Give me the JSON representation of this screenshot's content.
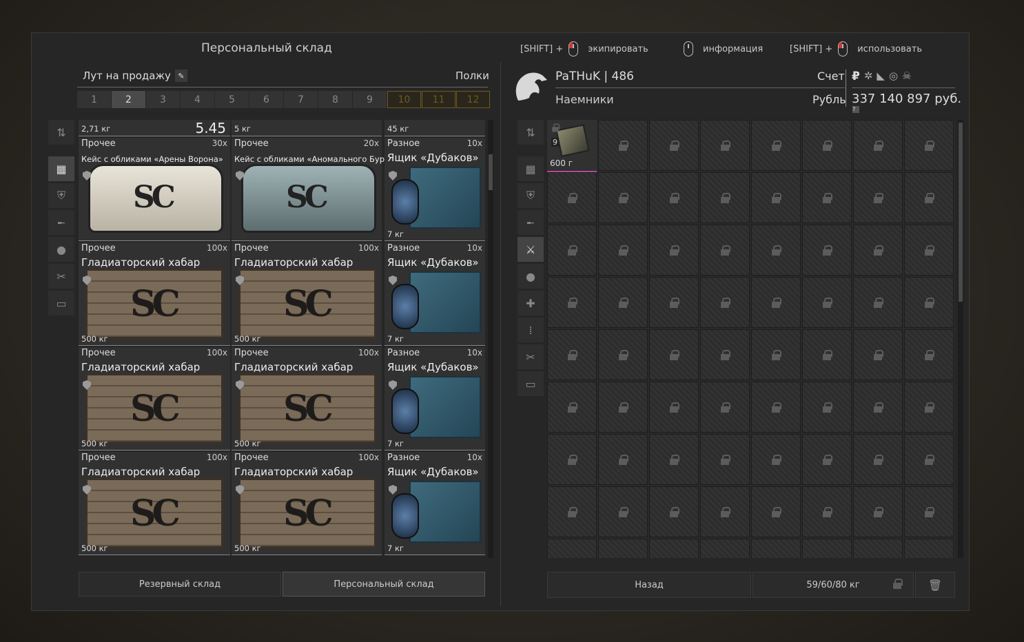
{
  "header": {
    "title": "Персональный склад",
    "hints": [
      {
        "pre": "[SHIFT] +",
        "label": "экипировать"
      },
      {
        "pre": "",
        "label": "информация"
      },
      {
        "pre": "[SHIFT] +",
        "label": "использовать"
      }
    ]
  },
  "left": {
    "sell_label": "Лут на продажу",
    "shelves_label": "Полки",
    "pages": [
      "1",
      "2",
      "3",
      "4",
      "5",
      "6",
      "7",
      "8",
      "9",
      "10",
      "11",
      "12"
    ],
    "active_page": "2",
    "top_row": [
      {
        "weight": "2,71 кг",
        "price": "5.45"
      },
      {
        "weight": "5 кг"
      },
      {
        "weight": "45 кг"
      }
    ],
    "items": [
      [
        {
          "cat": "Прочее",
          "count": "30x",
          "name": "Кейс с обликами «Арены Ворона»",
          "weight": ""
        },
        {
          "cat": "Прочее",
          "count": "20x",
          "name": "Кейс с обликами «Аномального Бура...",
          "weight": ""
        },
        {
          "cat": "Разное",
          "count": "10x",
          "name": "Ящик «Дубаков»",
          "weight": "7 кг"
        }
      ],
      [
        {
          "cat": "Прочее",
          "count": "100x",
          "name": "Гладиаторский хабар",
          "weight": "500 кг"
        },
        {
          "cat": "Прочее",
          "count": "100x",
          "name": "Гладиаторский хабар",
          "weight": "500 кг"
        },
        {
          "cat": "Разное",
          "count": "10x",
          "name": "Ящик «Дубаков»",
          "weight": "7 кг"
        }
      ],
      [
        {
          "cat": "Прочее",
          "count": "100x",
          "name": "Гладиаторский хабар",
          "weight": "500 кг"
        },
        {
          "cat": "Прочее",
          "count": "100x",
          "name": "Гладиаторский хабар",
          "weight": "500 кг"
        },
        {
          "cat": "Разное",
          "count": "10x",
          "name": "Ящик «Дубаков»",
          "weight": "7 кг"
        }
      ],
      [
        {
          "cat": "Прочее",
          "count": "100x",
          "name": "Гладиаторский хабар",
          "weight": "500 кг"
        },
        {
          "cat": "Прочее",
          "count": "100x",
          "name": "Гладиаторский хабар",
          "weight": "500 кг"
        },
        {
          "cat": "Разное",
          "count": "10x",
          "name": "Ящик «Дубаков»",
          "weight": "7 кг"
        }
      ]
    ],
    "btn_reserve": "Резервный склад",
    "btn_personal": "Персональный склад"
  },
  "right": {
    "player": "PaTHuK | 486",
    "faction": "Наемники",
    "account_label": "Счет",
    "currency_label": "Рубль",
    "currency_symbol": "₽",
    "balance": "337 140 897 руб.",
    "balance_info": "?",
    "item": {
      "count": "9",
      "weight": "600 г"
    },
    "btn_back": "Назад",
    "weight_total": "59/60/80 кг"
  }
}
